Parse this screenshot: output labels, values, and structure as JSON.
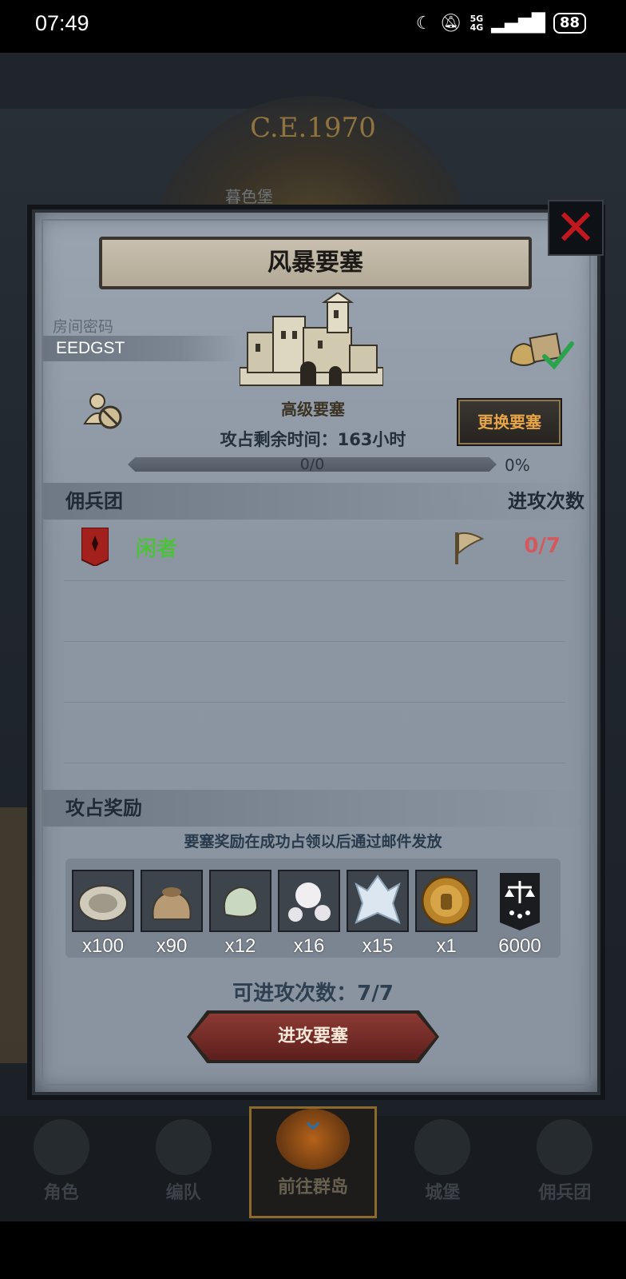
{
  "status_bar": {
    "time": "07:49",
    "net_top": "5G",
    "net_bottom": "4G",
    "battery": "88"
  },
  "background": {
    "era_text": "C.E.1970",
    "location_label": "暮色堡"
  },
  "modal": {
    "title": "风暴要塞",
    "room_code_label": "房间密码",
    "room_code": "EEDGST",
    "fortress_type": "高级要塞",
    "change_button": "更换要塞",
    "time_left": "攻占剩余时间：163小时",
    "progress_text": "0/0",
    "progress_percent": "0%",
    "progress_value": 0,
    "guild_header": "佣兵团",
    "attacks_header": "进攻次数",
    "guild_rows": [
      {
        "name": "闲者",
        "attack_count": "0/7"
      }
    ],
    "reward_header": "攻占奖励",
    "reward_note": "要塞奖励在成功占领以后通过邮件发放",
    "rewards": [
      {
        "icon": "oyster-icon",
        "qty": "x100"
      },
      {
        "icon": "sack-icon",
        "qty": "x90"
      },
      {
        "icon": "jade-stone-icon",
        "qty": "x12"
      },
      {
        "icon": "pearl-icon",
        "qty": "x16"
      },
      {
        "icon": "crystal-icon",
        "qty": "x15"
      },
      {
        "icon": "knight-medal-icon",
        "qty": "x1"
      },
      {
        "icon": "guild-banner-icon",
        "qty": "6000"
      }
    ],
    "attacks_left": "可进攻次数：7/7",
    "attack_button": "进攻要塞"
  },
  "nav": {
    "items": [
      {
        "label": "角色"
      },
      {
        "label": "编队"
      },
      {
        "label": "前往群岛"
      },
      {
        "label": "城堡"
      },
      {
        "label": "佣兵团"
      }
    ],
    "active_index": 2
  },
  "colors": {
    "guild_name": "#4fbf3e",
    "attack_count": "#d25a5f",
    "change_button_text": "#e8a548",
    "close_x": "#c0181e"
  }
}
